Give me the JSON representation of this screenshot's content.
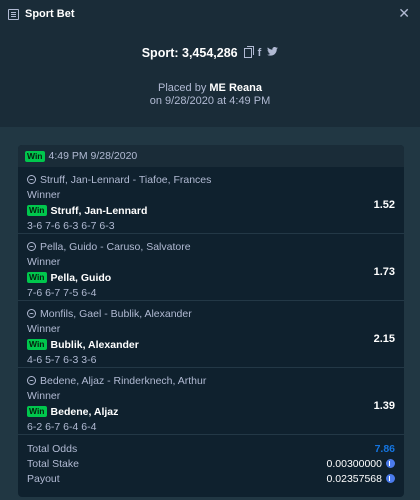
{
  "window": {
    "title": "Sport Bet"
  },
  "header": {
    "sport_label": "Sport: 3,454,286",
    "placed_by_prefix": "Placed by",
    "placed_by_user": "ME Reana",
    "placed_on": "on 9/28/2020 at 4:49 PM"
  },
  "bet": {
    "status_badge": "Win",
    "timestamp": "4:49 PM 9/28/2020",
    "legs": [
      {
        "match": "Struff, Jan-Lennard - Tiafoe, Frances",
        "market": "Winner",
        "badge": "Win",
        "pick": "Struff, Jan-Lennard",
        "score": "3-6 7-6 6-3 6-7 6-3",
        "odds": "1.52"
      },
      {
        "match": "Pella, Guido - Caruso, Salvatore",
        "market": "Winner",
        "badge": "Win",
        "pick": "Pella, Guido",
        "score": "7-6 6-7 7-5 6-4",
        "odds": "1.73"
      },
      {
        "match": "Monfils, Gael - Bublik, Alexander",
        "market": "Winner",
        "badge": "Win",
        "pick": "Bublik, Alexander",
        "score": "4-6 5-7 6-3 3-6",
        "odds": "2.15"
      },
      {
        "match": "Bedene, Aljaz - Rinderknech, Arthur",
        "market": "Winner",
        "badge": "Win",
        "pick": "Bedene, Aljaz",
        "score": "6-2 6-7 6-4 6-4",
        "odds": "1.39"
      }
    ],
    "totals": {
      "odds_label": "Total Odds",
      "odds_value": "7.86",
      "stake_label": "Total Stake",
      "stake_value": "0.00300000",
      "payout_label": "Payout",
      "payout_value": "0.02357568"
    }
  },
  "colors": {
    "win_green": "#00c74d",
    "odds_blue": "#1475e1",
    "coin_blue": "#4b7bec"
  },
  "icons": {
    "title": "ticket-icon",
    "copy": "copy-icon",
    "facebook": "facebook-icon",
    "twitter": "twitter-icon",
    "sport": "tennis-ball-icon",
    "currency": "coin-icon"
  }
}
